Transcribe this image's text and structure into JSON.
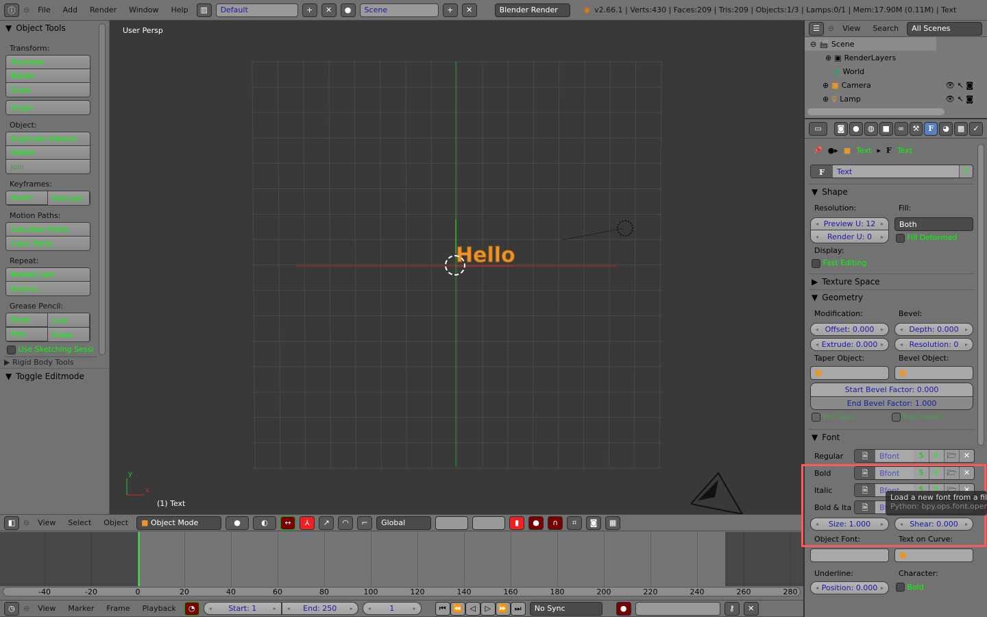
{
  "topbar": {
    "menus": [
      "File",
      "Add",
      "Render",
      "Window",
      "Help"
    ],
    "screen_layout": "Default",
    "scene": "Scene",
    "render_engine": "Blender Render",
    "stats": "v2.66.1 | Verts:430 | Faces:209 | Tris:209 | Objects:1/3 | Lamps:0/1 | Mem:17.90M (0.11M) | Text"
  },
  "toolshelf": {
    "title": "Object Tools",
    "transform_label": "Transform:",
    "transform": [
      "Translate",
      "Rotate",
      "Scale"
    ],
    "origin": "Origin",
    "object_label": "Object:",
    "object": [
      "Duplicate Objects",
      "Delete",
      "Join"
    ],
    "keyframes_label": "Keyframes:",
    "keyframes": [
      "Insert",
      "Remove"
    ],
    "motion_label": "Motion Paths:",
    "motion": [
      "Calculate Paths",
      "Clear Paths"
    ],
    "repeat_label": "Repeat:",
    "repeat": [
      "Repeat Last",
      "History..."
    ],
    "grease_label": "Grease Pencil:",
    "grease": [
      "Draw",
      "Line",
      "Poly",
      "Erase"
    ],
    "sketching": "Use Sketching Sessi",
    "collapsed": "Rigid Body Tools",
    "toggle_editmode": "Toggle Editmode"
  },
  "viewport": {
    "view_name": "User Persp",
    "object_info": "(1) Text",
    "text_object": "Hello",
    "axis_x": "x",
    "axis_y": "y"
  },
  "view3d_header": {
    "menus": [
      "View",
      "Select",
      "Object"
    ],
    "mode": "Object Mode",
    "orientation": "Global"
  },
  "timeline": {
    "ticks": [
      -40,
      -20,
      0,
      20,
      40,
      60,
      80,
      100,
      120,
      140,
      160,
      180,
      200,
      220,
      240,
      260,
      280
    ],
    "current_frame_marker": 0
  },
  "timeline_header": {
    "menus": [
      "View",
      "Marker",
      "Frame",
      "Playback"
    ],
    "start": "Start: 1",
    "end": "End: 250",
    "current": "1",
    "sync": "No Sync"
  },
  "outliner": {
    "menus": [
      "View",
      "Search"
    ],
    "filter": "All Scenes",
    "items": [
      "Scene",
      "RenderLayers",
      "World",
      "Camera",
      "Lamp"
    ]
  },
  "properties": {
    "breadcrumb": [
      "Text",
      "Text"
    ],
    "datablock": "Text",
    "datablock_flag": "F",
    "shape": {
      "title": "Shape",
      "resolution_label": "Resolution:",
      "preview_u": "Preview U: 12",
      "render_u": "Render U: 0",
      "fill_label": "Fill:",
      "fill": "Both",
      "fill_deformed": "Fill Deformed",
      "display_label": "Display:",
      "fast_editing": "Fast Editing"
    },
    "texture_space": "Texture Space",
    "geometry": {
      "title": "Geometry",
      "modification_label": "Modification:",
      "offset": "Offset: 0.000",
      "extrude": "Extrude: 0.000",
      "bevel_label": "Bevel:",
      "depth": "Depth: 0.000",
      "resolution": "Resolution: 0",
      "taper_label": "Taper Object:",
      "bevel_object_label": "Bevel Object:",
      "start_bevel": "Start Bevel Factor: 0.000",
      "end_bevel": "End Bevel Factor: 1.000",
      "fill_caps": "Fill Caps",
      "map_taper": "Map Taper"
    },
    "font": {
      "title": "Font",
      "rows": [
        {
          "label": "Regular",
          "font": "Bfont"
        },
        {
          "label": "Bold",
          "font": "Bfont"
        },
        {
          "label": "Italic",
          "font": "Bfont"
        },
        {
          "label": "Bold & Ita",
          "font": "Bfont"
        }
      ],
      "users": "5",
      "fake": "F",
      "size": "Size: 1.000",
      "shear": "Shear: 0.000",
      "object_font_label": "Object Font:",
      "text_on_curve_label": "Text on Curve:",
      "underline_label": "Underline:",
      "position": "Position: 0.000",
      "character_label": "Character:",
      "bold": "Bold"
    },
    "tooltip": {
      "title": "Load a new font from a file",
      "python": "Python: bpy.ops.font.open()"
    },
    "highlight_color": "#ff5a5a"
  }
}
